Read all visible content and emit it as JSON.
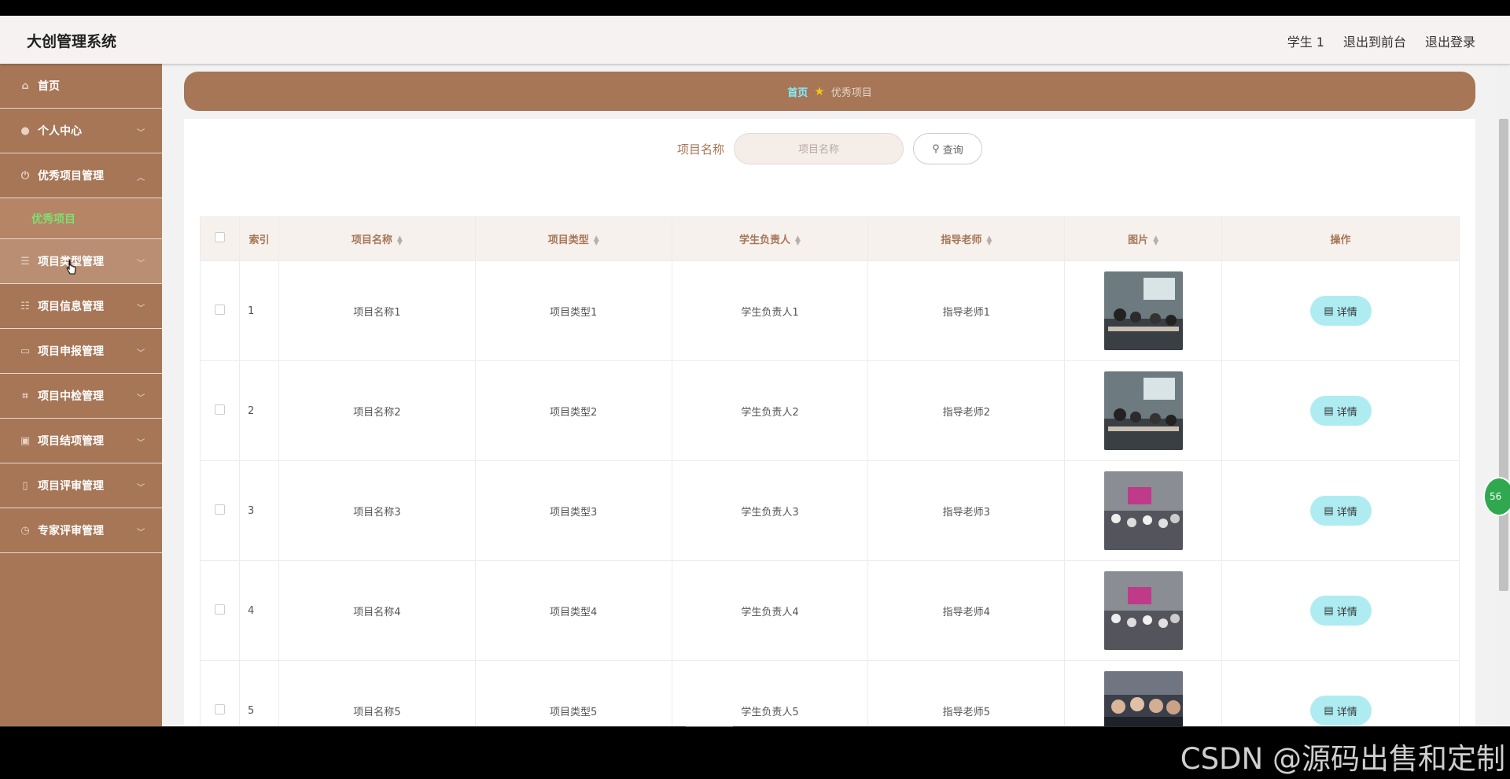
{
  "header": {
    "title": "大创管理系统",
    "links": [
      "学生 1",
      "退出到前台",
      "退出登录"
    ]
  },
  "sidebar": {
    "items": [
      {
        "label": "首页",
        "icon": "home-icon"
      },
      {
        "label": "个人中心",
        "icon": "user-icon"
      },
      {
        "label": "优秀项目管理",
        "icon": "power-icon",
        "expanded": true,
        "children": [
          "优秀项目"
        ]
      },
      {
        "label": "项目类型管理",
        "icon": "list-icon"
      },
      {
        "label": "项目信息管理",
        "icon": "filter-icon"
      },
      {
        "label": "项目申报管理",
        "icon": "card-icon"
      },
      {
        "label": "项目中检管理",
        "icon": "crop-icon"
      },
      {
        "label": "项目结项管理",
        "icon": "clipboard-icon"
      },
      {
        "label": "项目评审管理",
        "icon": "phone-icon"
      },
      {
        "label": "专家评审管理",
        "icon": "clock-icon"
      }
    ]
  },
  "breadcrumb": {
    "home": "首页",
    "current": "优秀项目"
  },
  "search": {
    "label": "项目名称",
    "placeholder": "项目名称",
    "button": "查询"
  },
  "table": {
    "headers": [
      "索引",
      "项目名称",
      "项目类型",
      "学生负责人",
      "指导老师",
      "图片",
      "操作"
    ],
    "action_label": "详情",
    "rows": [
      {
        "index": "1",
        "name": "项目名称1",
        "type": "项目类型1",
        "leader": "学生负责人1",
        "teacher": "指导老师1"
      },
      {
        "index": "2",
        "name": "项目名称2",
        "type": "项目类型2",
        "leader": "学生负责人2",
        "teacher": "指导老师2"
      },
      {
        "index": "3",
        "name": "项目名称3",
        "type": "项目类型3",
        "leader": "学生负责人3",
        "teacher": "指导老师3"
      },
      {
        "index": "4",
        "name": "项目名称4",
        "type": "项目类型4",
        "leader": "学生负责人4",
        "teacher": "指导老师4"
      },
      {
        "index": "5",
        "name": "项目名称5",
        "type": "项目类型5",
        "leader": "学生负责人5",
        "teacher": "指导老师5"
      }
    ]
  },
  "badge": "56",
  "watermark": "CSDN @源码出售和定制",
  "colors": {
    "accent": "#a67657",
    "header": "#f6f2f1",
    "active": "#7ee06f",
    "detail_button": "#aeecf2"
  }
}
